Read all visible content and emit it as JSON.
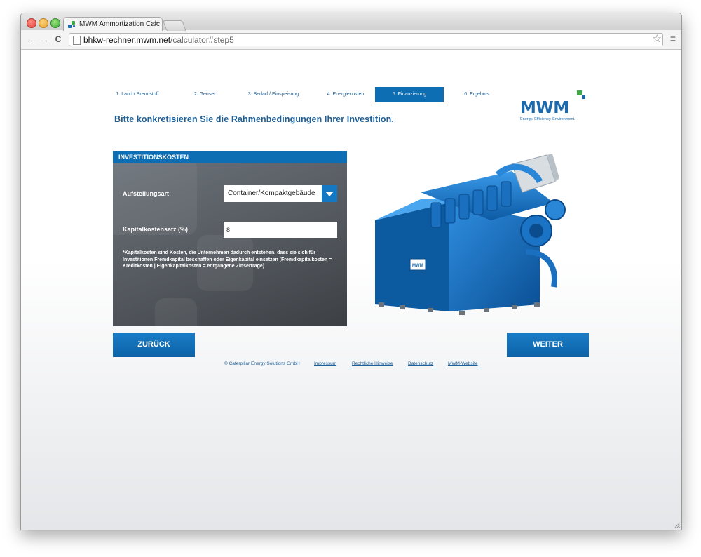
{
  "browser": {
    "tab_title": "MWM Ammortization Calc",
    "tab_close": "×",
    "url_host": "bhkw-rechner.mwm.net",
    "url_path": "/calculator#step5",
    "back_icon": "←",
    "forward_icon": "→",
    "reload_icon": "C",
    "star_icon": "☆",
    "menu_icon": "≡"
  },
  "steps": [
    {
      "label": "1. Land / Brennstoff",
      "active": false
    },
    {
      "label": "2. Genset",
      "active": false
    },
    {
      "label": "3. Bedarf / Einspeisung",
      "active": false
    },
    {
      "label": "4. Energiekosten",
      "active": false
    },
    {
      "label": "5. Finanzierung",
      "active": true
    },
    {
      "label": "6. Ergebnis",
      "active": false
    }
  ],
  "headline": "Bitte konkretisieren Sie die Rahmenbedingungen Ihrer Investition.",
  "logo": {
    "text": "MWM",
    "tagline": "Energy. Efficiency. Environment.",
    "colors": {
      "blue": "#1c6aab",
      "green": "#3fa844"
    }
  },
  "panel": {
    "title": "INVESTITIONSKOSTEN",
    "setup_label": "Aufstellungsart",
    "setup_value": "Container/Kompaktgebäude",
    "rate_label": "Kapitalkostensatz (%)",
    "rate_value": "8",
    "note": "*Kapitalkosten sind Kosten, die Unternehmen dadurch entstehen, dass sie sich für Investitionen Fremdkapital beschaffen oder Eigenkapital einsetzen (Fremdkapitalkosten = Kreditkosten | Eigenkapitalkosten = entgangene Zinserträge)"
  },
  "buttons": {
    "back": "ZURÜCK",
    "next": "WEITER"
  },
  "engine_badge": "MWM",
  "footer": {
    "copyright": "© Caterpillar Energy Solutions GmbH",
    "links": [
      "Impressum",
      "Rechtliche Hinweise",
      "Datenschutz",
      "MWM-Website"
    ]
  },
  "colors": {
    "accent": "#0e6eb4",
    "panel": "#54595f"
  }
}
